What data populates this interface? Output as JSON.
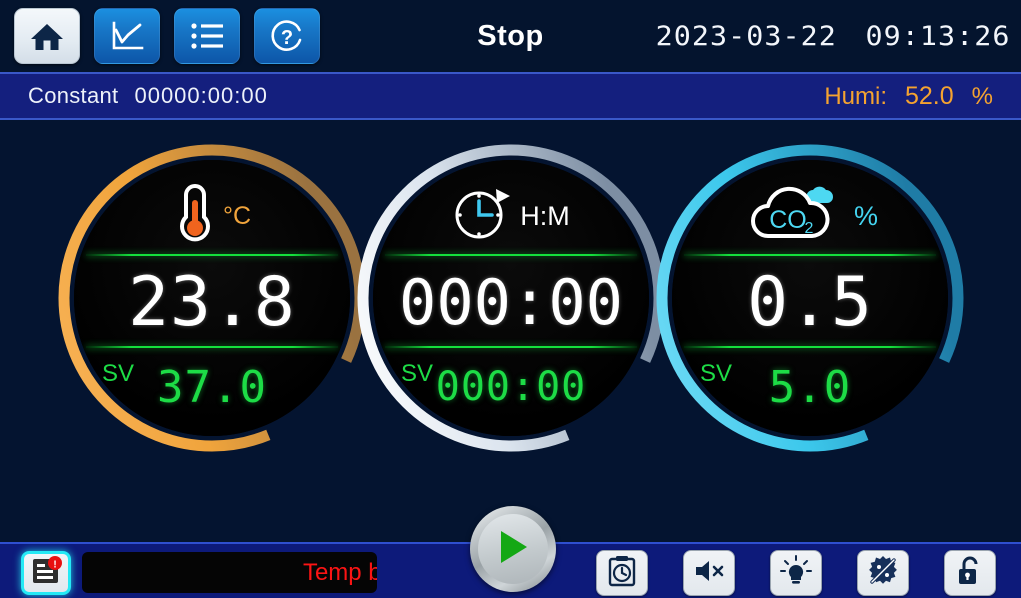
{
  "header": {
    "title": "Stop",
    "date": "2023-03-22",
    "time": "09:13:26",
    "buttons": [
      {
        "name": "home",
        "label": "Home",
        "icon": "home-icon",
        "active": true
      },
      {
        "name": "chart",
        "label": "Chart",
        "icon": "chart-line-icon",
        "active": false
      },
      {
        "name": "list",
        "label": "List",
        "icon": "list-icon",
        "active": false
      },
      {
        "name": "help",
        "label": "Help",
        "icon": "question-circle-icon",
        "active": false
      }
    ]
  },
  "statusbar": {
    "mode": "Constant",
    "elapsed": "00000:00:00",
    "humi_label": "Humi:",
    "humi_value": "52.0",
    "humi_unit": "%",
    "accent_color": "#f5a330"
  },
  "gauges": [
    {
      "id": "temp",
      "icon": "thermometer-icon",
      "unit": "°C",
      "pv": "23.8",
      "sv_label": "SV",
      "sv": "37.0",
      "ring_color": "#f0a43c"
    },
    {
      "id": "timer",
      "icon": "clock-rotate-icon",
      "unit": "H:M",
      "pv": "000:00",
      "sv_label": "SV",
      "sv": "000:00",
      "ring_color": "#c8d4e2"
    },
    {
      "id": "co2",
      "icon": "co2-cloud-icon",
      "unit": "%",
      "pv": "0.5",
      "sv_label": "SV",
      "sv": "5.0",
      "ring_color": "#3cc8ec"
    }
  ],
  "bottombar": {
    "alarm_icon": "alarm-log-icon",
    "alarm_badge": "!",
    "ticker_text": "Temp bo",
    "ticker_color": "#fc1414",
    "play_icon": "play-icon",
    "functions": [
      {
        "name": "schedule",
        "icon": "clipboard-clock-icon"
      },
      {
        "name": "mute",
        "icon": "speaker-mute-icon"
      },
      {
        "name": "light",
        "icon": "lightbulb-icon"
      },
      {
        "name": "sterilize",
        "icon": "germ-slash-icon"
      },
      {
        "name": "lock",
        "icon": "padlock-unlocked-icon"
      }
    ]
  }
}
